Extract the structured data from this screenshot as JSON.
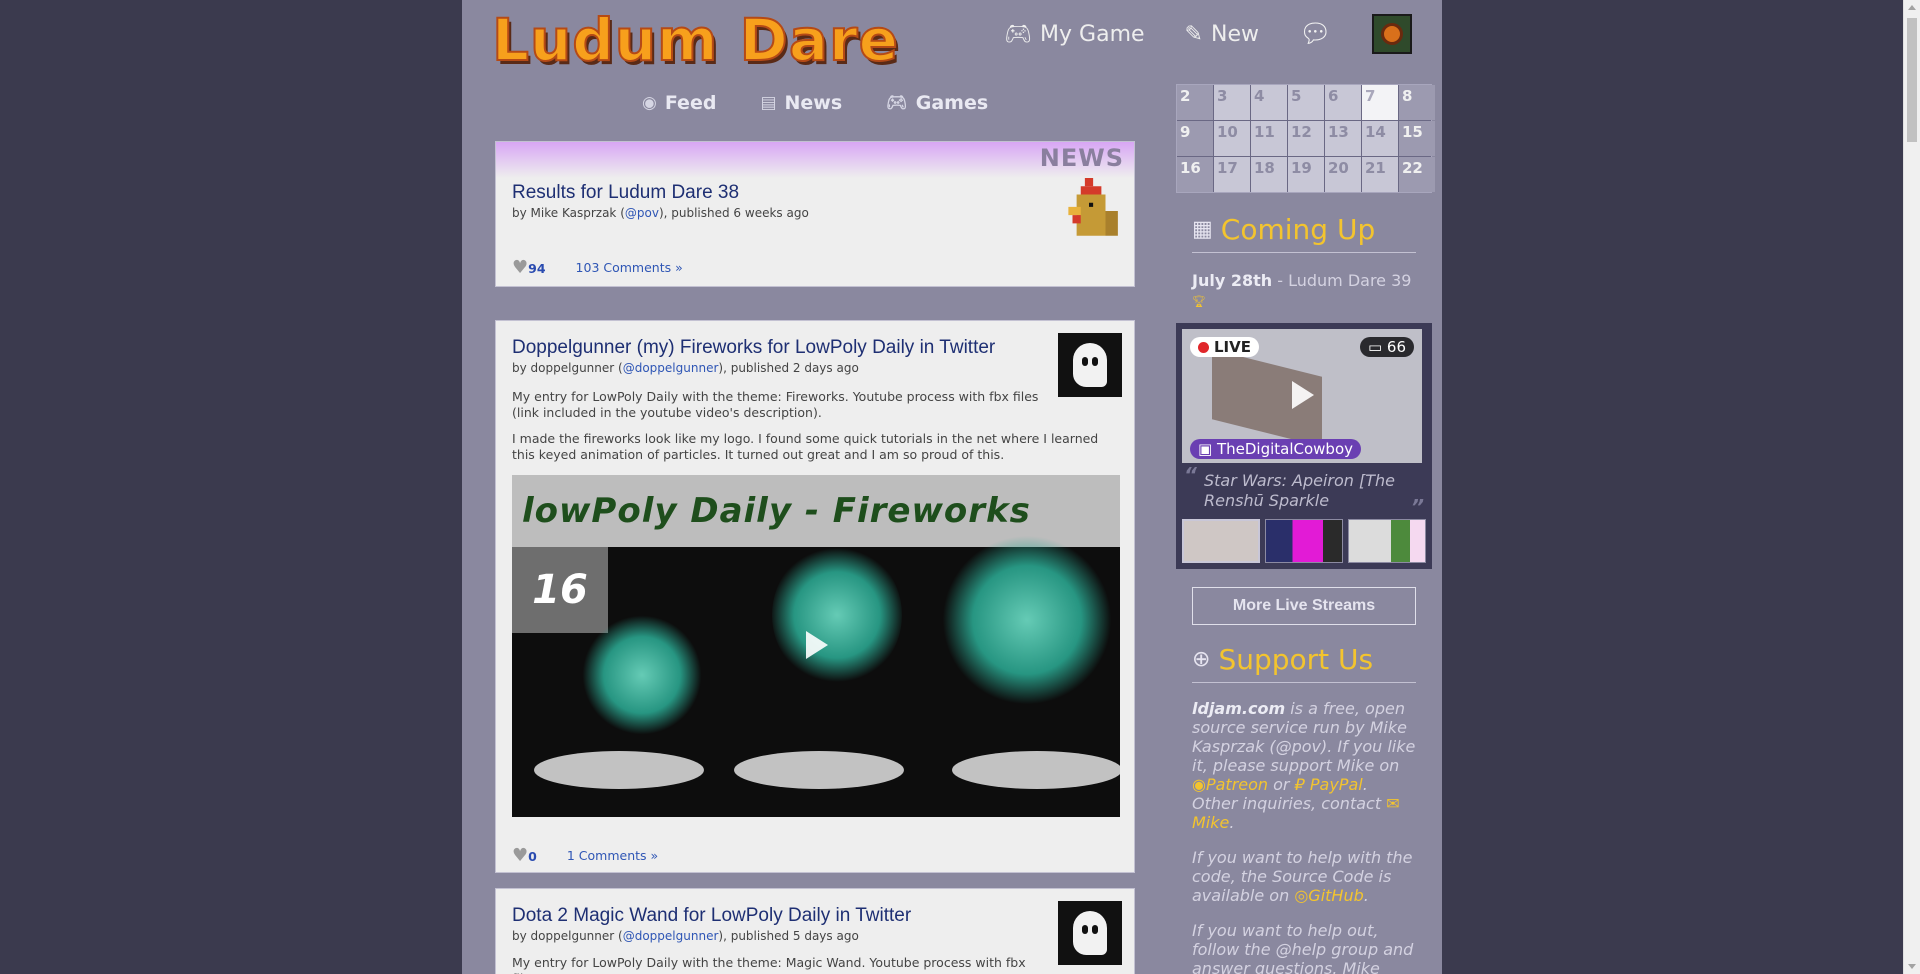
{
  "brand": {
    "logo": "Ludum Dare"
  },
  "topnav": {
    "my_game": "My Game",
    "new": "New"
  },
  "subnav": {
    "feed": "Feed",
    "news": "News",
    "games": "Games"
  },
  "news_post": {
    "tag": "NEWS",
    "title": "Results for Ludum Dare 38",
    "author": "Mike Kasprzak",
    "handle": "@pov",
    "published": "published 6 weeks ago",
    "likes": "94",
    "comments": "103 Comments »"
  },
  "post1": {
    "title": "Doppelgunner (my) Fireworks for LowPoly Daily in Twitter",
    "author": "doppelgunner",
    "handle": "@doppelgunner",
    "published": "published 2 days ago",
    "para1": "My entry for LowPoly Daily with the theme: Fireworks. Youtube process with fbx files (link included in the youtube video's description).",
    "para2": "I made the fireworks look like my logo. I found some quick tutorials in the net where I learned this keyed animation of particles. It turned out great and I am so proud of this.",
    "video_banner": "lowPoly Daily - Fireworks",
    "video_number": "16",
    "likes": "0",
    "comments": "1 Comments »"
  },
  "post2": {
    "title": "Dota 2 Magic Wand for LowPoly Daily in Twitter",
    "author": "doppelgunner",
    "handle": "@doppelgunner",
    "published": "published 5 days ago",
    "para1": "My entry for LowPoly Daily with the theme: Magic Wand. Youtube process with fbx files"
  },
  "calendar": {
    "days": [
      "2",
      "3",
      "4",
      "5",
      "6",
      "7",
      "8",
      "9",
      "10",
      "11",
      "12",
      "13",
      "14",
      "15",
      "16",
      "17",
      "18",
      "19",
      "20",
      "21",
      "22"
    ]
  },
  "coming_up": {
    "heading": "Coming Up",
    "date": "July 28th",
    "event": " - Ludum Dare 39"
  },
  "stream": {
    "live": "LIVE",
    "viewers": "66",
    "channel": "TheDigitalCowboy",
    "title": "Star Wars: Apeiron [The Renshū Sparkle",
    "more_button": "More Live Streams"
  },
  "support": {
    "heading": "Support Us",
    "p1_site": "ldjam.com",
    "p1_a": " is a free, open source service run by Mike Kasprzak (@pov). If you like it, please support Mike on ",
    "patreon": "Patreon",
    "p1_or": " or ",
    "paypal": "PayPal",
    "p1_b": ". Other inquiries, contact ",
    "mike": "Mike",
    "p2_a": "If you want to help with the code, the Source Code is available on ",
    "github": "GitHub",
    "p3": "If you want to help out, follow the @help group and answer questions. Mike"
  },
  "colors": {
    "accent": "#f3c42e",
    "link": "#2f56b5",
    "title": "#1e2f73",
    "page_bg": "#8a889f"
  }
}
